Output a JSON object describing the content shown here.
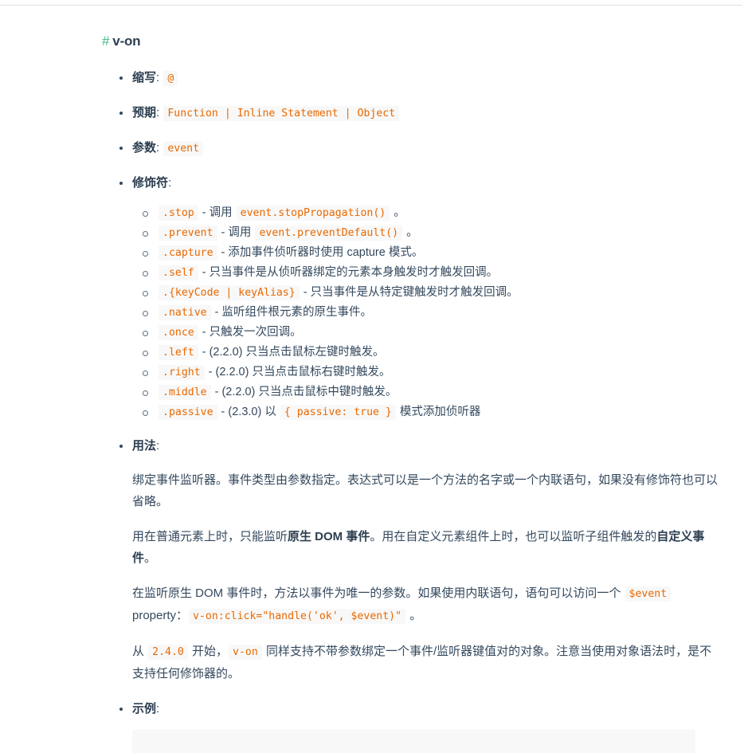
{
  "heading": {
    "anchor": "#",
    "title": "v-on"
  },
  "entries": [
    {
      "term": "缩写",
      "colon": ":",
      "code": "@"
    },
    {
      "term": "预期",
      "colon": ":",
      "code": "Function | Inline Statement | Object"
    },
    {
      "term": "参数",
      "colon": ":",
      "code": "event"
    },
    {
      "term": "修饰符",
      "colon": ":"
    },
    {
      "term": "用法",
      "colon": ":"
    },
    {
      "term": "示例",
      "colon": ":"
    }
  ],
  "modifiers": [
    {
      "code": ".stop",
      "text_a": " - 调用 ",
      "code2": "event.stopPropagation()",
      "text_b": " 。"
    },
    {
      "code": ".prevent",
      "text_a": " - 调用 ",
      "code2": "event.preventDefault()",
      "text_b": " 。"
    },
    {
      "code": ".capture",
      "text_a": " - 添加事件侦听器时使用 capture 模式。"
    },
    {
      "code": ".self",
      "text_a": " - 只当事件是从侦听器绑定的元素本身触发时才触发回调。"
    },
    {
      "code": ".{keyCode | keyAlias}",
      "text_a": " - 只当事件是从特定键触发时才触发回调。"
    },
    {
      "code": ".native",
      "text_a": " - 监听组件根元素的原生事件。"
    },
    {
      "code": ".once",
      "text_a": " - 只触发一次回调。"
    },
    {
      "code": ".left",
      "text_a": " - (2.2.0) 只当点击鼠标左键时触发。"
    },
    {
      "code": ".right",
      "text_a": " - (2.2.0) 只当点击鼠标右键时触发。"
    },
    {
      "code": ".middle",
      "text_a": " - (2.2.0) 只当点击鼠标中键时触发。"
    },
    {
      "code": ".passive",
      "text_a": " - (2.3.0) 以 ",
      "code2": "{ passive: true }",
      "text_b": " 模式添加侦听器"
    }
  ],
  "usage": {
    "p1": "绑定事件监听器。事件类型由参数指定。表达式可以是一个方法的名字或一个内联语句，如果没有修饰符也可以省略。",
    "p2_a": "用在普通元素上时，只能监听",
    "p2_bold1": "原生 DOM 事件",
    "p2_b": "。用在自定义元素组件上时，也可以监听子组件触发的",
    "p2_bold2": "自定义事件",
    "p2_c": "。",
    "p3_a": "在监听原生 DOM 事件时，方法以事件为唯一的参数。如果使用内联语句，语句可以访问一个 ",
    "p3_code1": "$event",
    "p3_b": " property：",
    "p3_code2": "v-on:click=\"handle('ok', $event)\"",
    "p3_c": " 。",
    "p4_a": "从 ",
    "p4_code1": "2.4.0",
    "p4_b": " 开始，",
    "p4_code2": "v-on",
    "p4_c": " 同样支持不带参数绑定一个事件/监听器键值对的对象。注意当使用对象语法时，是不支持任何修饰器的。"
  },
  "colors": {
    "accent_green": "#42b983",
    "code_orange": "#e96900",
    "code_bg": "#f8f8f8",
    "text": "#34495e",
    "heading": "#2c3e50"
  }
}
